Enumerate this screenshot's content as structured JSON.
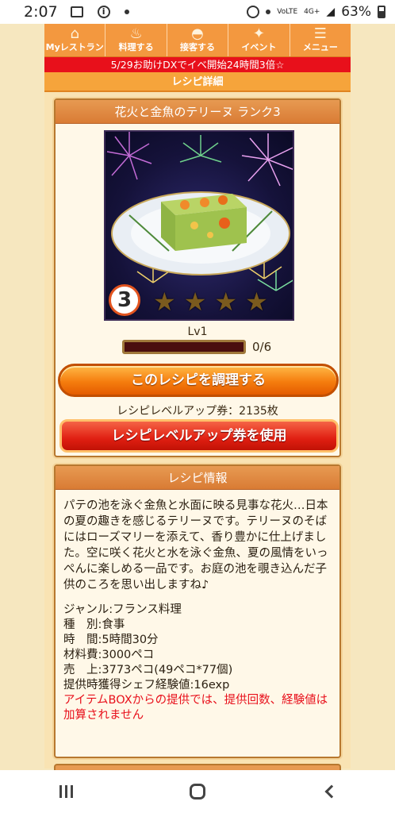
{
  "status_bar": {
    "time": "2:07",
    "network_label": "4G+",
    "volte_label": "VoLTE",
    "battery": "63%",
    "icons": [
      "gallery-icon",
      "info-icon",
      "dot-icon",
      "alarm-icon",
      "location-icon",
      "signal-icon",
      "battery-icon"
    ]
  },
  "nav": {
    "items": [
      {
        "label": "Myレストラン",
        "icon": "restaurant-icon"
      },
      {
        "label": "料理する",
        "icon": "pot-icon"
      },
      {
        "label": "接客する",
        "icon": "service-bell-icon"
      },
      {
        "label": "イベント",
        "icon": "event-icon"
      },
      {
        "label": "メニュー",
        "icon": "menu-icon"
      }
    ]
  },
  "ticker": "5/29お助けDXでイベ開始24時間3倍☆",
  "page_title": "レシピ詳細",
  "recipe": {
    "title": "花火と金魚のテリーヌ ランク3",
    "rank": "3",
    "stars_total": 4,
    "stars_filled": 0,
    "level_label": "Lv1",
    "progress_text": "0/6",
    "progress_fraction": 0,
    "cook_button": "このレシピを調理する",
    "ticket_count": "レシピレベルアップ券：2135枚",
    "use_ticket_button": "レシピレベルアップ券を使用"
  },
  "info": {
    "header": "レシピ情報",
    "description": "パテの池を泳ぐ金魚と水面に映る見事な花火…日本の夏の趣きを感じるテリーヌです。テリーヌのそばにはローズマリーを添えて、香り豊かに仕上げました。空に咲く花火と水を泳ぐ金魚、夏の風情をいっぺんに楽しめる一品です。お庭の池を覗き込んだ子供のころを思い出しますね♪",
    "genre": "ジャンル:フランス料理",
    "category": "種　別:食事",
    "time": "時　間:5時間30分",
    "ingredient_cost": "材料費:3000ペコ",
    "sales": "売　上:3773ペコ(49ペコ*77個)",
    "exp": "提供時獲得シェフ経験値:16exp",
    "warning": "アイテムBOXからの提供では、提供回数、経験値は加算されません"
  },
  "colors": {
    "accent_orange": "#f3983f",
    "ticker_red": "#e8101b",
    "panel_border": "#b7782f"
  }
}
